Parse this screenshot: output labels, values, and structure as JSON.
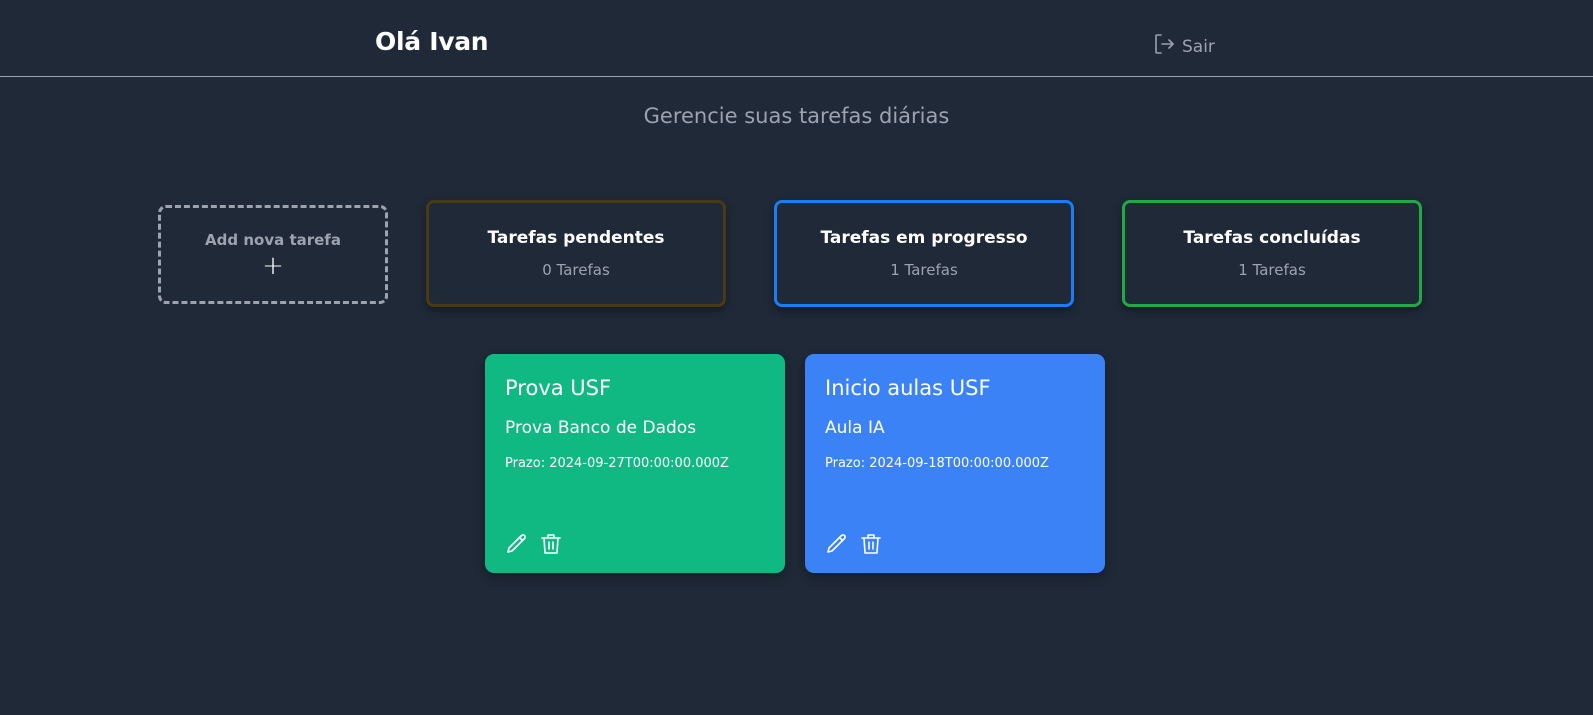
{
  "header": {
    "greeting": "Olá Ivan",
    "logout_label": "Sair"
  },
  "subtitle": "Gerencie suas tarefas diárias",
  "add_task": {
    "label": "Add nova tarefa",
    "plus": "+"
  },
  "stats": [
    {
      "title": "Tarefas pendentes",
      "count": "0 Tarefas",
      "color": "#4a3a12"
    },
    {
      "title": "Tarefas em progresso",
      "count": "1 Tarefas",
      "color": "#1d7cf2"
    },
    {
      "title": "Tarefas concluídas",
      "count": "1 Tarefas",
      "color": "#22a845"
    }
  ],
  "tasks": [
    {
      "title": "Prova USF",
      "description": "Prova Banco de Dados",
      "deadline": "Prazo: 2024-09-27T00:00:00.000Z",
      "color": "#10b981"
    },
    {
      "title": "Inicio aulas USF",
      "description": "Aula IA",
      "deadline": "Prazo: 2024-09-18T00:00:00.000Z",
      "color": "#3b82f6"
    }
  ],
  "icons": {
    "logout": "logout-icon",
    "edit": "pencil-icon",
    "delete": "trash-icon"
  },
  "colors": {
    "background": "#1f2937",
    "muted_text": "#9ca3af"
  }
}
